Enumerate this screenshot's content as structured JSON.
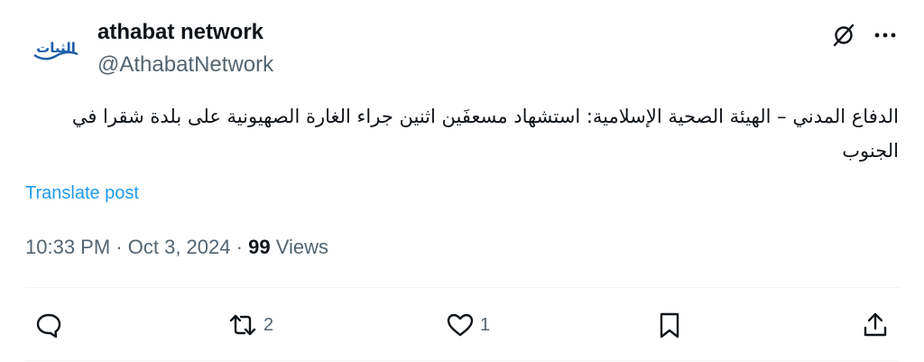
{
  "author": {
    "display_name": "athabat network",
    "handle": "@AthabatNetwork",
    "avatar_text": "الثبات"
  },
  "header_icons": {
    "left": "grok-slash-icon",
    "right": "more-icon"
  },
  "tweet": {
    "text": "الدفاع المدني – الهيئة الصحية الإسلامية: استشهاد مسعفَين اثنين جراء الغارة الصهيونية على بلدة شقرا في الجنوب",
    "translate_label": "Translate post",
    "time": "10:33 PM",
    "separator": "·",
    "date": "Oct 3, 2024",
    "views_count": "99",
    "views_label": "Views"
  },
  "actions": {
    "reply": {
      "icon": "reply-icon",
      "count": ""
    },
    "repost": {
      "icon": "repost-icon",
      "count": "2"
    },
    "like": {
      "icon": "heart-icon",
      "count": "1"
    },
    "bookmark": {
      "icon": "bookmark-icon",
      "count": ""
    },
    "share": {
      "icon": "share-icon",
      "count": ""
    }
  },
  "colors": {
    "text": "#0f1419",
    "secondary": "#536471",
    "link": "#1d9bf0",
    "divider": "#eff3f4",
    "avatar_brand": "#1f5fa8"
  }
}
